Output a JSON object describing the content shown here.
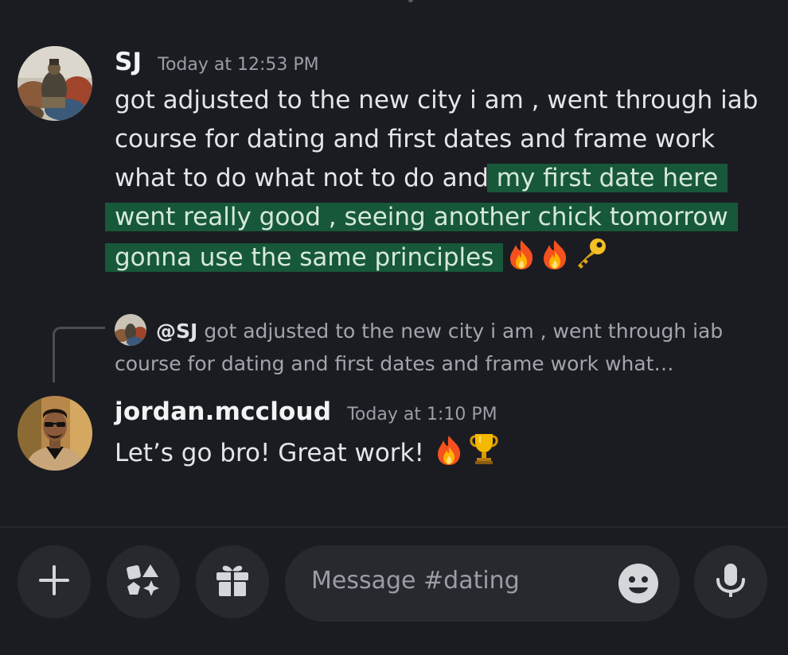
{
  "channel": "dating",
  "messages": [
    {
      "author": "SJ",
      "timestamp": "Today at 12:53 PM",
      "text_plain": "got adjusted to the new city i am , went through iab course for dating and first dates and frame work what to do what not to do and ",
      "text_highlighted": "my first date here went really good , seeing another chick tomorrow gonna use the same principles",
      "emojis": [
        "fire",
        "fire",
        "key"
      ]
    },
    {
      "author": "jordan.mccloud",
      "timestamp": "Today at 1:10 PM",
      "reply_to": {
        "mention": "@SJ",
        "preview": "got adjusted to the new city i am , went through iab course for dating and first dates and frame work what…"
      },
      "text": "Let’s go bro! Great work!",
      "emojis": [
        "fire",
        "trophy"
      ]
    }
  ],
  "composer": {
    "placeholder": "Message #dating",
    "buttons": [
      "plus-icon",
      "apps-icon",
      "gift-icon",
      "emoji-icon",
      "microphone-icon"
    ]
  },
  "colors": {
    "background": "#1b1c21",
    "highlight": "#17583a",
    "button": "#27292f"
  }
}
